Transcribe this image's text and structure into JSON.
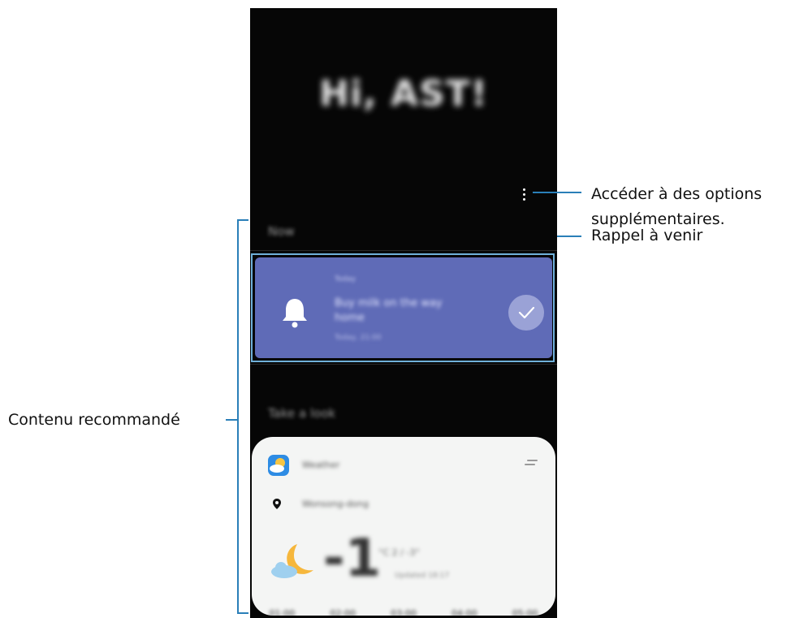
{
  "greeting": "Hi, AST!",
  "sections": {
    "now_label": "Now",
    "take_a_look_label": "Take a look"
  },
  "reminder": {
    "small_label": "Today",
    "title": "Buy milk on the way home",
    "meta": "Today, 21:00"
  },
  "weather": {
    "app_name": "Weather",
    "location": "Wonsong-dong",
    "temperature": "-1",
    "detail": "°C 2 / -3°",
    "sub": "Updated 18:17",
    "hours": [
      "01:00",
      "02:00",
      "03:00",
      "04:00",
      "05:00"
    ]
  },
  "callouts": {
    "options": "Accéder à des options supplémentaires.",
    "reminder": "Rappel à venir",
    "recommended": "Contenu recommandé"
  },
  "colors": {
    "reminder_card": "#5f6bb7",
    "callout_line": "#2a7fb8",
    "phone_background": "#060606"
  },
  "icons": {
    "more": "more-vertical-icon",
    "bell": "bell-icon",
    "check": "check-icon",
    "weather_app": "weather-app-icon",
    "handle": "drag-handle-icon",
    "pin": "location-pin-icon",
    "moon_cloud": "moon-cloud-icon"
  }
}
